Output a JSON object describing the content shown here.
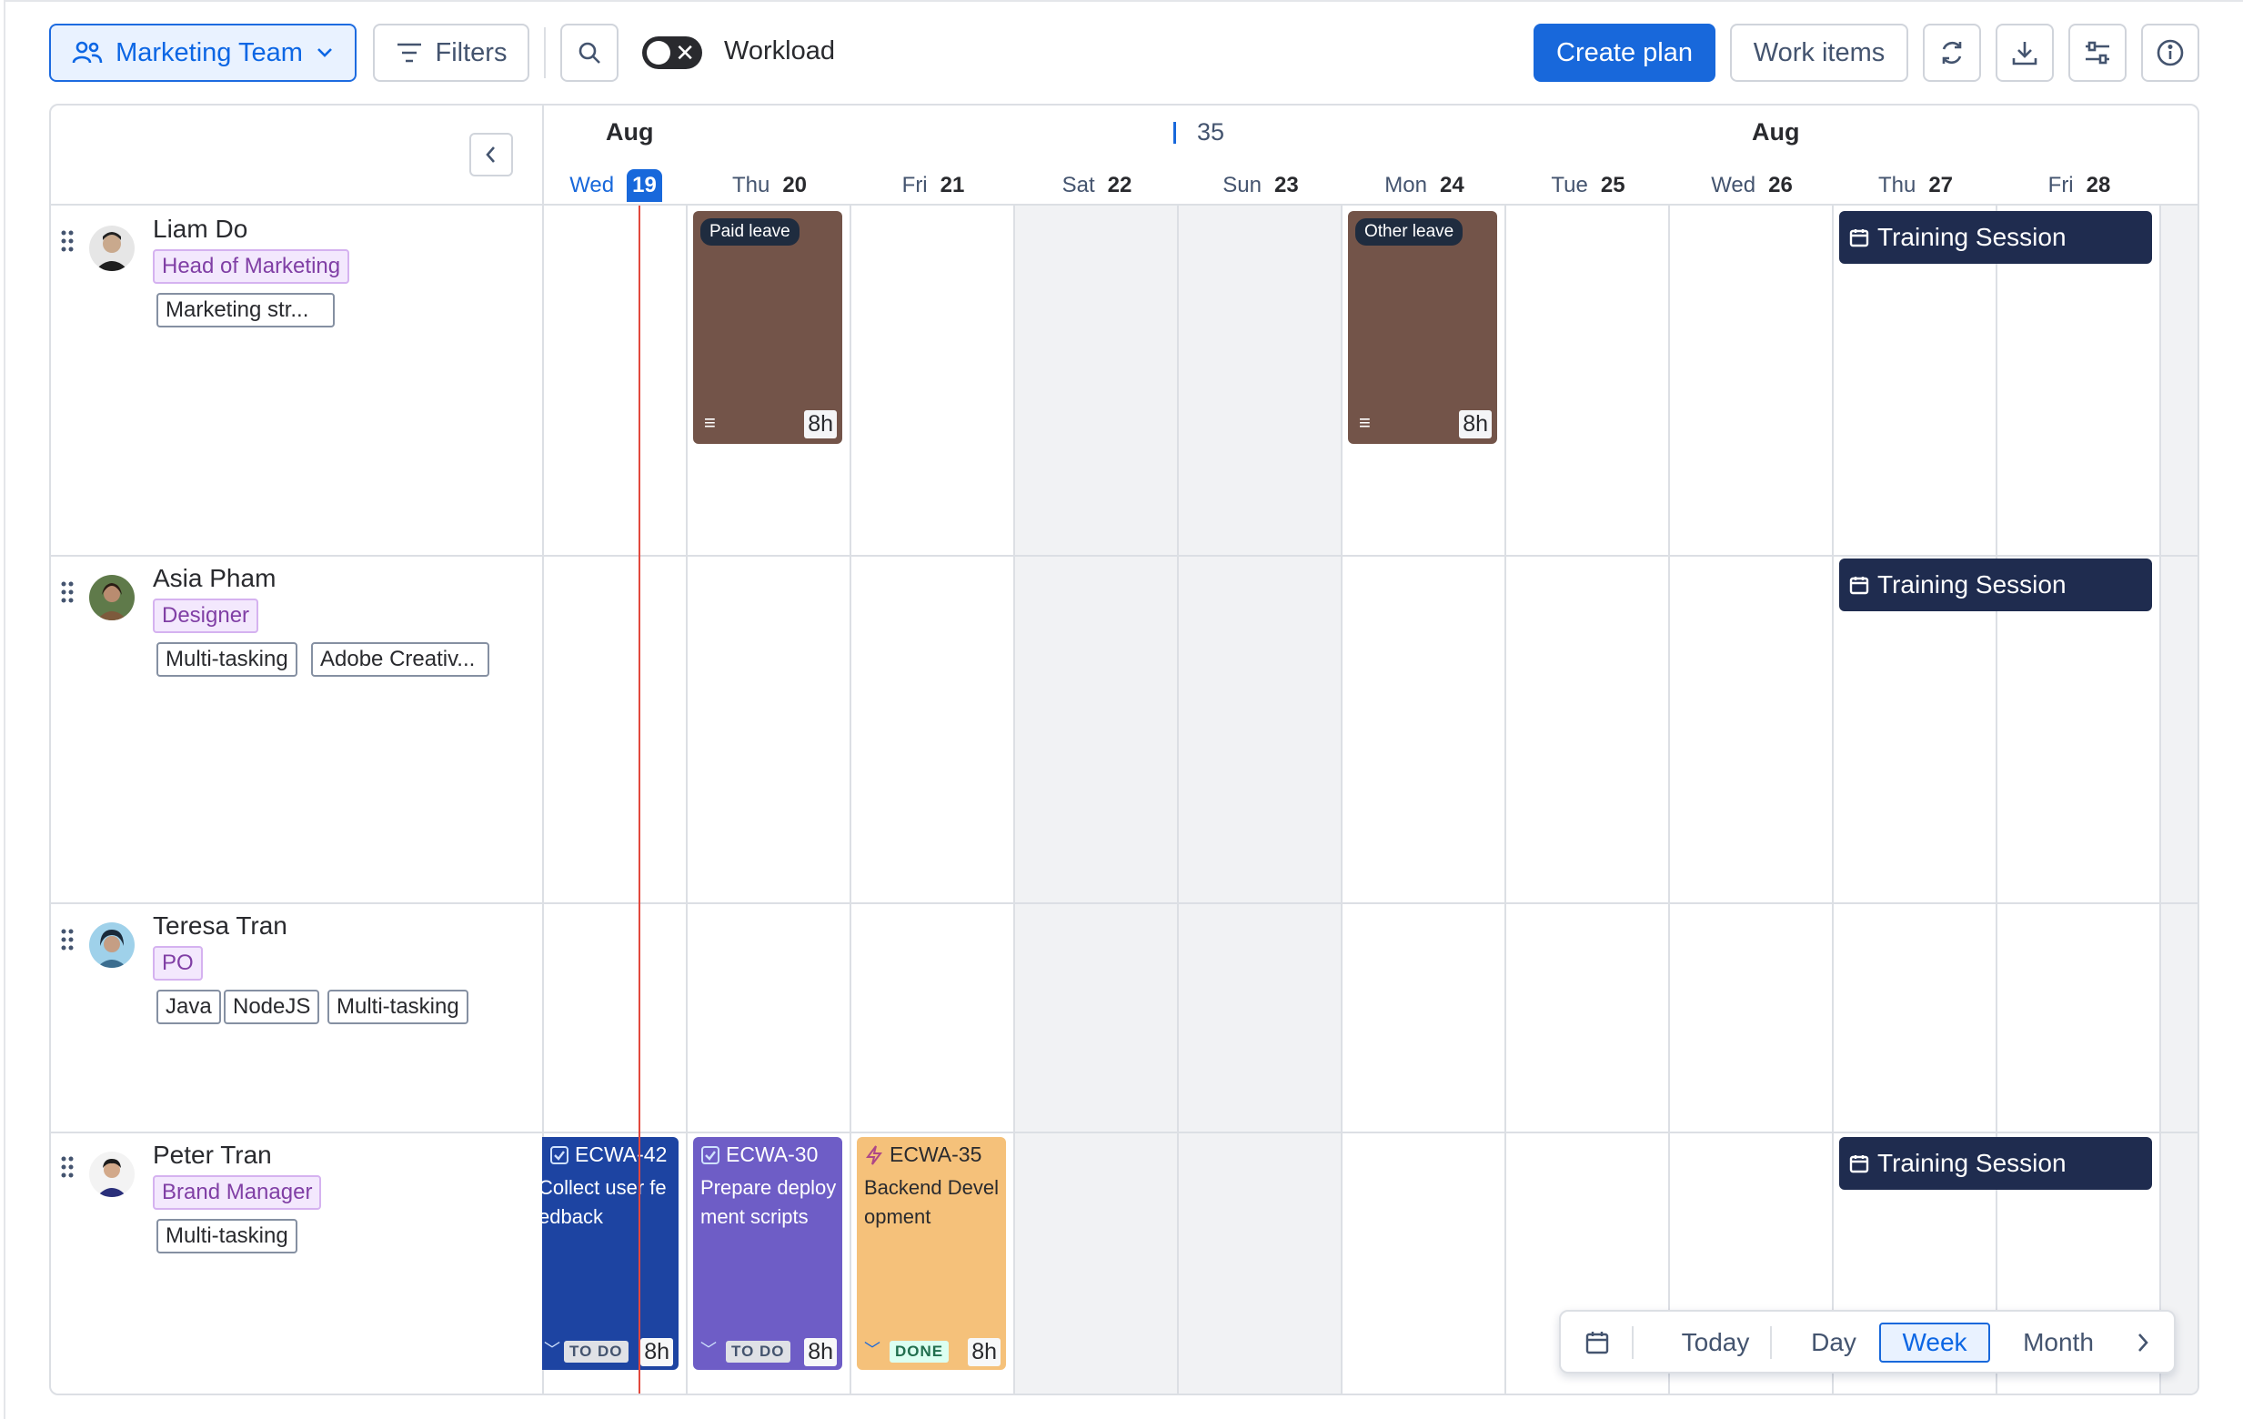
{
  "toolbar": {
    "team_label": "Marketing Team",
    "filters_label": "Filters",
    "workload_label": "Workload",
    "create_plan_label": "Create plan",
    "work_items_label": "Work items"
  },
  "timeline": {
    "months": [
      "Aug",
      "Aug"
    ],
    "week_number": "35",
    "days": [
      {
        "name": "Wed",
        "date": "19"
      },
      {
        "name": "Thu",
        "date": "20"
      },
      {
        "name": "Fri",
        "date": "21"
      },
      {
        "name": "Sat",
        "date": "22"
      },
      {
        "name": "Sun",
        "date": "23"
      },
      {
        "name": "Mon",
        "date": "24"
      },
      {
        "name": "Tue",
        "date": "25"
      },
      {
        "name": "Wed",
        "date": "26"
      },
      {
        "name": "Thu",
        "date": "27"
      },
      {
        "name": "Fri",
        "date": "28"
      }
    ]
  },
  "people": [
    {
      "name": "Liam Do",
      "role": "Head of Marketing",
      "skills": [
        "Marketing str..."
      ]
    },
    {
      "name": "Asia Pham",
      "role": "Designer",
      "skills": [
        "Multi-tasking",
        "Adobe Creativ..."
      ]
    },
    {
      "name": "Teresa Tran",
      "role": "PO",
      "skills": [
        "Java",
        "NodeJS",
        "Multi-tasking"
      ]
    },
    {
      "name": "Peter Tran",
      "role": "Brand Manager",
      "skills": [
        "Multi-tasking"
      ]
    }
  ],
  "leaves": [
    {
      "label": "Paid leave",
      "hours": "8h"
    },
    {
      "label": "Other leave",
      "hours": "8h"
    }
  ],
  "training": {
    "label": "Training Session"
  },
  "tasks": [
    {
      "key": "ECWA-42",
      "title": "Collect user feedback",
      "status": "TO DO",
      "hours": "8h"
    },
    {
      "key": "ECWA-30",
      "title": "Prepare deployment scripts",
      "status": "TO DO",
      "hours": "8h"
    },
    {
      "key": "ECWA-35",
      "title": "Backend Development",
      "status": "DONE",
      "hours": "8h"
    }
  ],
  "nav": {
    "today": "Today",
    "day": "Day",
    "week": "Week",
    "month": "Month"
  },
  "colors": {
    "accent": "#1868db",
    "leave": "#735449",
    "training": "#1f2c4f",
    "task_todo_blue": "#1d44a2",
    "task_todo_purple": "#6e5dc6",
    "task_done": "#f5c17a",
    "today_line": "#e2483d"
  }
}
